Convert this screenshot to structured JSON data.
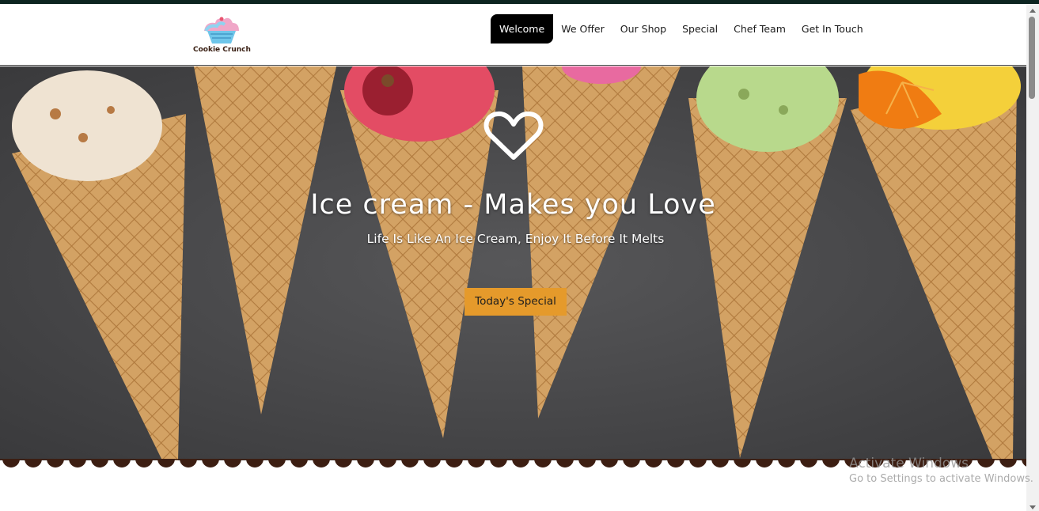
{
  "brand": {
    "name": "Cookie Crunch"
  },
  "nav": {
    "items": [
      {
        "label": "Welcome",
        "active": true
      },
      {
        "label": "We Offer"
      },
      {
        "label": "Our Shop"
      },
      {
        "label": "Special"
      },
      {
        "label": "Chef Team"
      },
      {
        "label": "Get In Touch"
      }
    ]
  },
  "hero": {
    "icon": "heart-icon",
    "title": "Ice cream - Makes you Love",
    "subtitle": "Life Is Like An Ice Cream, Enjoy It Before It Melts",
    "button_label": "Today's Special"
  },
  "watermark": {
    "title": "Activate Windows",
    "subtitle": "Go to Settings to activate Windows."
  },
  "colors": {
    "accent_button": "#e59a2b",
    "nav_active_bg": "#000000",
    "scallop": "#3c1e12",
    "hero_background": "#4a4a4c",
    "cone": "#d2a063"
  }
}
